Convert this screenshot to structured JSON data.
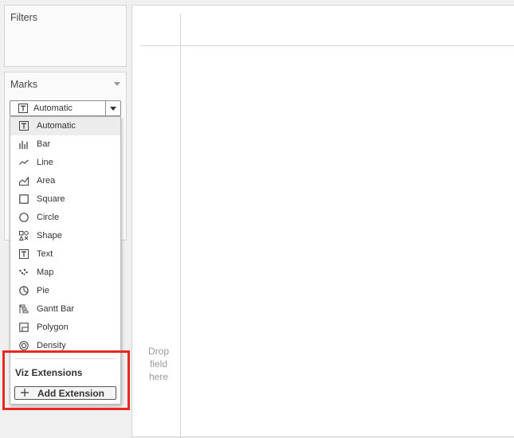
{
  "filters": {
    "title": "Filters"
  },
  "marks": {
    "title": "Marks",
    "selected_type": "Automatic"
  },
  "mark_types": [
    {
      "label": "Automatic",
      "icon": "text-t-icon",
      "selected": true
    },
    {
      "label": "Bar",
      "icon": "bar-icon"
    },
    {
      "label": "Line",
      "icon": "line-icon"
    },
    {
      "label": "Area",
      "icon": "area-icon"
    },
    {
      "label": "Square",
      "icon": "square-icon"
    },
    {
      "label": "Circle",
      "icon": "circle-icon"
    },
    {
      "label": "Shape",
      "icon": "shape-icon"
    },
    {
      "label": "Text",
      "icon": "text-t-icon"
    },
    {
      "label": "Map",
      "icon": "map-icon"
    },
    {
      "label": "Pie",
      "icon": "pie-icon"
    },
    {
      "label": "Gantt Bar",
      "icon": "gantt-icon"
    },
    {
      "label": "Polygon",
      "icon": "polygon-icon"
    },
    {
      "label": "Density",
      "icon": "density-icon"
    }
  ],
  "viz_extensions": {
    "title": "Viz Extensions",
    "add_label": "Add Extension"
  },
  "view": {
    "drop_text": "Drop\nfield\nhere"
  },
  "colors": {
    "highlight": "#e8281d",
    "selected_row": "#ececec"
  }
}
